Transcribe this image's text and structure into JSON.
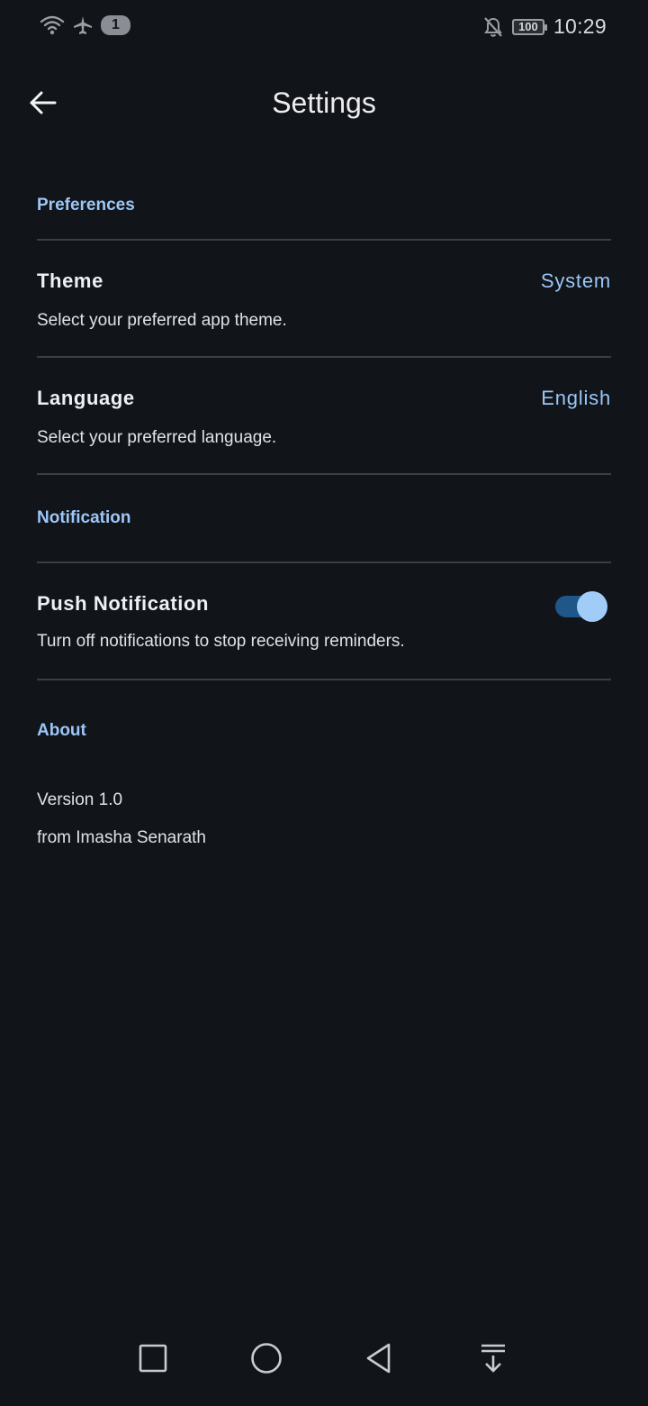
{
  "status_bar": {
    "sim_badge": "1",
    "battery": "100",
    "time": "10:29",
    "icons": [
      "wifi-icon",
      "airplane-icon",
      "notifications-off-icon",
      "battery-icon"
    ]
  },
  "app_bar": {
    "title": "Settings",
    "back_icon": "arrow-back-icon"
  },
  "sections": {
    "preferences": {
      "header": "Preferences",
      "theme": {
        "title": "Theme",
        "description": "Select your preferred app theme.",
        "value": "System"
      },
      "language": {
        "title": "Language",
        "description": "Select your preferred language.",
        "value": "English"
      }
    },
    "notification": {
      "header": "Notification",
      "push": {
        "title": "Push Notification",
        "description": "Turn off notifications to stop receiving reminders.",
        "enabled": true
      }
    },
    "about": {
      "header": "About",
      "version": "Version 1.0",
      "author": "from Imasha Senarath"
    }
  },
  "nav_bar": {
    "icons": [
      "recents-square-icon",
      "home-circle-icon",
      "back-triangle-icon",
      "notification-pulldown-icon"
    ]
  },
  "colors": {
    "background": "#111419",
    "accent": "#9cc6f7",
    "divider": "#3a3e45",
    "toggle_track": "#1e5788",
    "toggle_knob": "#a2ccf8"
  }
}
